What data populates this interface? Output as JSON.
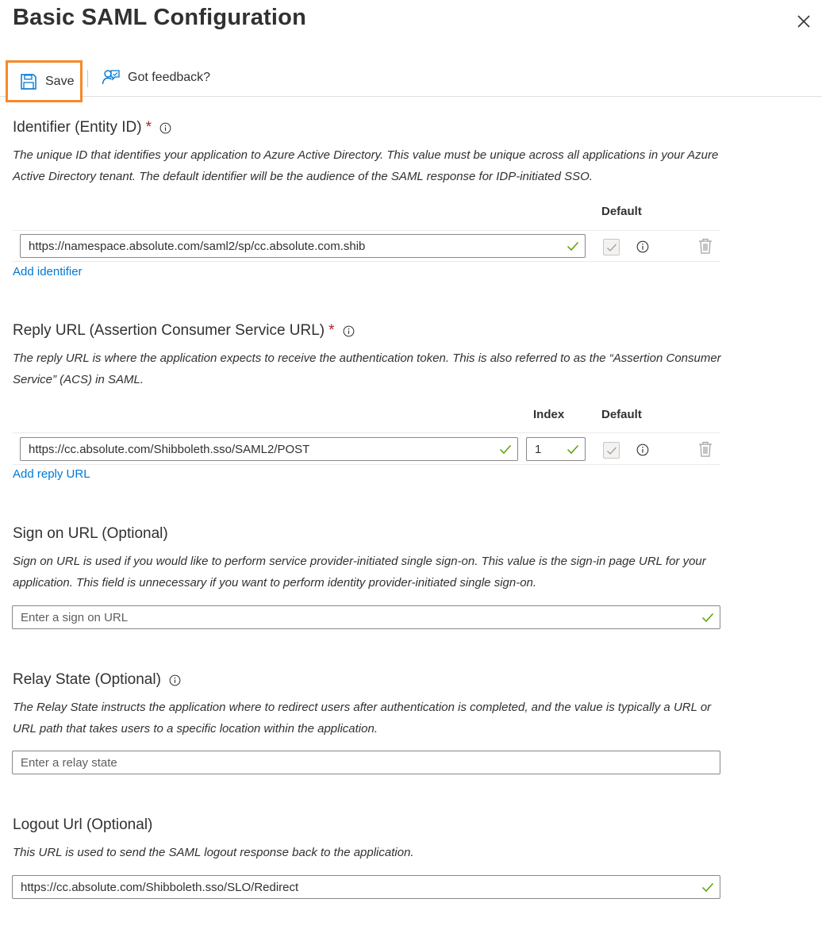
{
  "panel": {
    "title": "Basic SAML Configuration",
    "close_icon": "close-icon"
  },
  "toolbar": {
    "save_label": "Save",
    "save_icon": "save-icon",
    "feedback_label": "Got feedback?",
    "feedback_icon": "feedback-icon",
    "save_highlight_color": "#f7892a"
  },
  "identifier": {
    "title": "Identifier (Entity ID)",
    "required_mark": "*",
    "description": "The unique ID that identifies your application to Azure Active Directory. This value must be unique across all applications in your Azure Active Directory tenant. The default identifier will be the audience of the SAML response for IDP-initiated SSO.",
    "default_header": "Default",
    "value": "https://namespace.absolute.com/saml2/sp/cc.absolute.com.shib",
    "default_checked": true,
    "add_link": "Add identifier"
  },
  "reply_url": {
    "title": "Reply URL (Assertion Consumer Service URL)",
    "required_mark": "*",
    "description": "The reply URL is where the application expects to receive the authentication token. This is also referred to as the “Assertion Consumer Service” (ACS) in SAML.",
    "index_header": "Index",
    "default_header": "Default",
    "value": "https://cc.absolute.com/Shibboleth.sso/SAML2/POST",
    "index_value": "1",
    "default_checked": true,
    "add_link": "Add reply URL"
  },
  "sign_on": {
    "title": "Sign on URL (Optional)",
    "description": "Sign on URL is used if you would like to perform service provider-initiated single sign-on. This value is the sign-in page URL for your application. This field is unnecessary if you want to perform identity provider-initiated single sign-on.",
    "placeholder": "Enter a sign on URL"
  },
  "relay_state": {
    "title": "Relay State (Optional)",
    "description": "The Relay State instructs the application where to redirect users after authentication is completed, and the value is typically a URL or URL path that takes users to a specific location within the application.",
    "placeholder": "Enter a relay state"
  },
  "logout": {
    "title": "Logout Url (Optional)",
    "description": "This URL is used to send the SAML logout response back to the application.",
    "value": "https://cc.absolute.com/Shibboleth.sso/SLO/Redirect"
  },
  "colors": {
    "accent": "#0078d4",
    "valid_check": "#57a300",
    "required": "#a4262c"
  }
}
